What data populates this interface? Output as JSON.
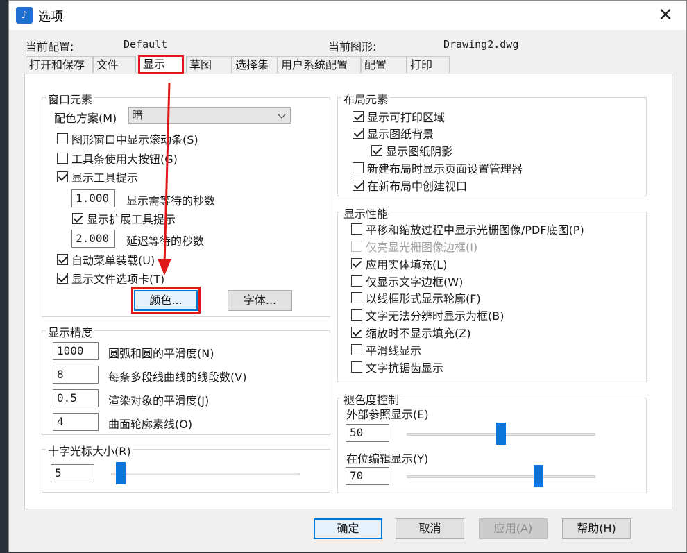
{
  "window": {
    "title": "选项",
    "app_icon": "autocad-logo-icon",
    "close_glyph": "✕"
  },
  "info": {
    "profile_label": "当前配置:",
    "profile_value": "Default",
    "drawing_label": "当前图形:",
    "drawing_value": "Drawing2.dwg"
  },
  "tabs": [
    {
      "label": "打开和保存"
    },
    {
      "label": "文件"
    },
    {
      "label": "显示",
      "active": true
    },
    {
      "label": "草图"
    },
    {
      "label": "选择集"
    },
    {
      "label": "用户系统配置"
    },
    {
      "label": "配置"
    },
    {
      "label": "打印"
    }
  ],
  "window_elements": {
    "title": "窗口元素",
    "color_scheme_label": "配色方案(M)",
    "color_scheme_value": "暗",
    "checkboxes": [
      {
        "label": "图形窗口中显示滚动条(S)",
        "checked": false
      },
      {
        "label": "工具条使用大按钮(G)",
        "checked": false
      },
      {
        "label": "显示工具提示",
        "checked": true
      }
    ],
    "tooltip_delay_value": "1.000",
    "tooltip_delay_label": "显示需等待的秒数",
    "extended_tooltip_label": "显示扩展工具提示",
    "extended_delay_value": "2.000",
    "extended_delay_label": "延迟等待的秒数",
    "auto_menu_label": "自动菜单装载(U)",
    "file_tabs_label": "显示文件选项卡(T)",
    "colors_button": "颜色...",
    "fonts_button": "字体..."
  },
  "display_resolution": {
    "title": "显示精度",
    "rows": [
      {
        "value": "1000",
        "label": "圆弧和圆的平滑度(N)"
      },
      {
        "value": "8",
        "label": "每条多段线曲线的线段数(V)"
      },
      {
        "value": "0.5",
        "label": "渲染对象的平滑度(J)"
      },
      {
        "value": "4",
        "label": "曲面轮廓素线(O)"
      }
    ]
  },
  "crosshair": {
    "title": "十字光标大小(R)",
    "value": "5",
    "slider_fraction": 0.05
  },
  "layout_elements": {
    "title": "布局元素",
    "checkboxes": [
      {
        "label": "显示可打印区域",
        "checked": true
      },
      {
        "label": "显示图纸背景",
        "checked": true
      },
      {
        "label": "显示图纸阴影",
        "checked": true
      },
      {
        "label": "新建布局时显示页面设置管理器",
        "checked": false
      },
      {
        "label": "在新布局中创建视口",
        "checked": true
      }
    ]
  },
  "display_performance": {
    "title": "显示性能",
    "checkboxes": [
      {
        "label": "平移和缩放过程中显示光栅图像/PDF底图(P)",
        "checked": false
      },
      {
        "label": "仅亮显光栅图像边框(I)",
        "checked": false,
        "disabled": true
      },
      {
        "label": "应用实体填充(L)",
        "checked": true
      },
      {
        "label": "仅显示文字边框(W)",
        "checked": false
      },
      {
        "label": "以线框形式显示轮廓(F)",
        "checked": false
      },
      {
        "label": "文字无法分辨时显示为框(B)",
        "checked": false
      },
      {
        "label": "缩放时不显示填充(Z)",
        "checked": true
      },
      {
        "label": "平滑线显示",
        "checked": false
      },
      {
        "label": "文字抗锯齿显示",
        "checked": false
      }
    ]
  },
  "fade_control": {
    "title": "褪色度控制",
    "xref_label": "外部参照显示(E)",
    "xref_value": "50",
    "xref_fraction": 0.5,
    "inplace_label": "在位编辑显示(Y)",
    "inplace_value": "70",
    "inplace_fraction": 0.7
  },
  "footer": {
    "ok": "确定",
    "cancel": "取消",
    "apply": "应用(A)",
    "help": "帮助(H)"
  },
  "colors": {
    "highlight": "#e11818",
    "accent": "#0a74da"
  }
}
